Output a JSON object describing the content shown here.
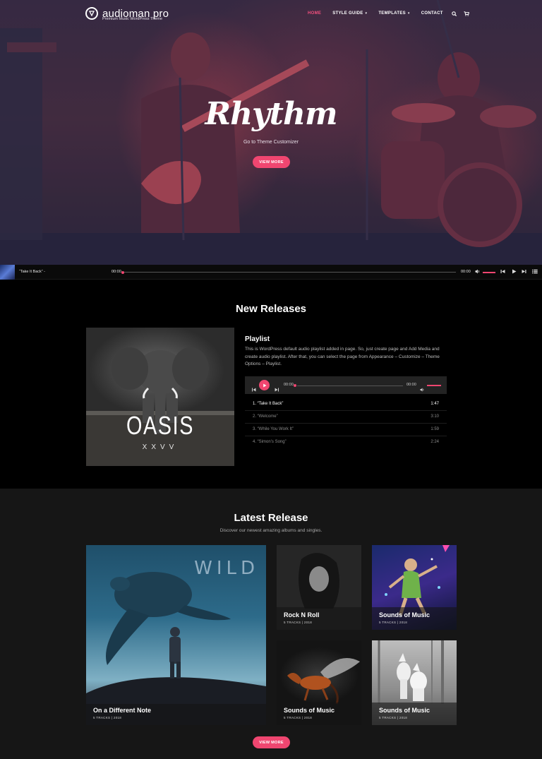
{
  "brand": {
    "name": "audioman pro",
    "tagline": "Premium Music WordPress Theme"
  },
  "nav": {
    "home": "HOME",
    "style_guide": "STYLE GUIDE",
    "templates": "TEMPLATES",
    "contact": "CONTACT"
  },
  "hero": {
    "title": "Rhythm",
    "subtitle": "Go to Theme Customizer",
    "button": "VIEW MORE"
  },
  "player_bar": {
    "track": "“Take It Back” -",
    "time_current": "00:00",
    "time_total": "00:00"
  },
  "new_releases": {
    "heading": "New Releases",
    "album": {
      "title": "OASIS",
      "subtitle": "XXVV"
    },
    "playlist": {
      "heading": "Playlist",
      "description": "This is WordPress default audio playlist added in page. So, just create page and Add Media and create audio playlist. After that, you can select the page from Appearance – Customize – Theme Options – Playlist.",
      "time_current": "00:00",
      "time_total": "00:00",
      "tracks": [
        {
          "label": "1. “Take It Back”",
          "duration": "1:47"
        },
        {
          "label": "2. “Welcome”",
          "duration": "3:10"
        },
        {
          "label": "3. “While You Work It”",
          "duration": "1:59"
        },
        {
          "label": "4. “Simon’s Song”",
          "duration": "2:24"
        }
      ]
    }
  },
  "latest_release": {
    "heading": "Latest Release",
    "subtitle": "Discover our newest amazing albums and singles.",
    "featured_word": "WILD",
    "cards": [
      {
        "title": "On a Different Note",
        "meta": "5 TRACKS  |  2018"
      },
      {
        "title": "Rock N Roll",
        "meta": "5 TRACKS  |  2018"
      },
      {
        "title": "Sounds of Music",
        "meta": "5 TRACKS  |  2018"
      },
      {
        "title": "Sounds of Music",
        "meta": "5 TRACKS  |  2018"
      },
      {
        "title": "Sounds of Music",
        "meta": "5 TRACKS  |  2018"
      }
    ],
    "button": "VIEW MORE"
  },
  "colors": {
    "accent": "#ef4670",
    "background": "#000000",
    "section_alt": "#161616"
  },
  "icons": [
    "logo-triangle-icon",
    "search-icon",
    "cart-icon",
    "play-icon",
    "prev-icon",
    "next-icon",
    "volume-icon",
    "playlist-icon"
  ]
}
